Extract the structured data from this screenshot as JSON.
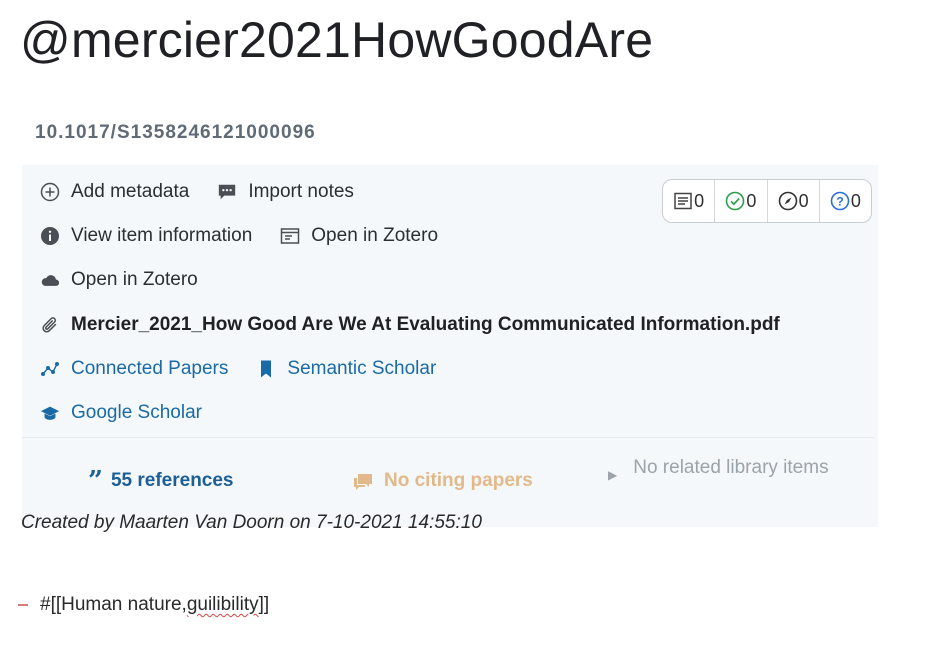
{
  "page": {
    "title": "@mercier2021HowGoodAre",
    "doi": "10.1017/S1358246121000096"
  },
  "actions": {
    "add_metadata": "Add metadata",
    "import_notes": "Import notes",
    "view_item_info": "View item information",
    "open_in_zotero_local": "Open in Zotero",
    "open_in_zotero_web": "Open in Zotero",
    "pdf_file": "Mercier_2021_How Good Are We At Evaluating Communicated Information.pdf",
    "connected_papers": "Connected Papers",
    "semantic_scholar": "Semantic Scholar",
    "google_scholar": "Google Scholar"
  },
  "counters": [
    {
      "icon": "notes-icon",
      "value": "0"
    },
    {
      "icon": "check-circle-icon",
      "value": "0"
    },
    {
      "icon": "compass-icon",
      "value": "0"
    },
    {
      "icon": "question-circle-icon",
      "value": "0"
    }
  ],
  "stats": {
    "references": "55 references",
    "citing": "No citing papers",
    "related": "No related library items"
  },
  "footer": {
    "created": "Created by Maarten Van Doorn on 7-10-2021 14:55:10",
    "tag_prefix": "#[[",
    "tag_text": "Human nature, ",
    "tag_misspelled": "guilibility",
    "tag_suffix": "]]"
  },
  "colors": {
    "link_blue": "#1a6aa6",
    "references_blue": "#1b5f96",
    "citing_tan": "#e2b98a",
    "panel_bg": "#f5f8fa"
  }
}
